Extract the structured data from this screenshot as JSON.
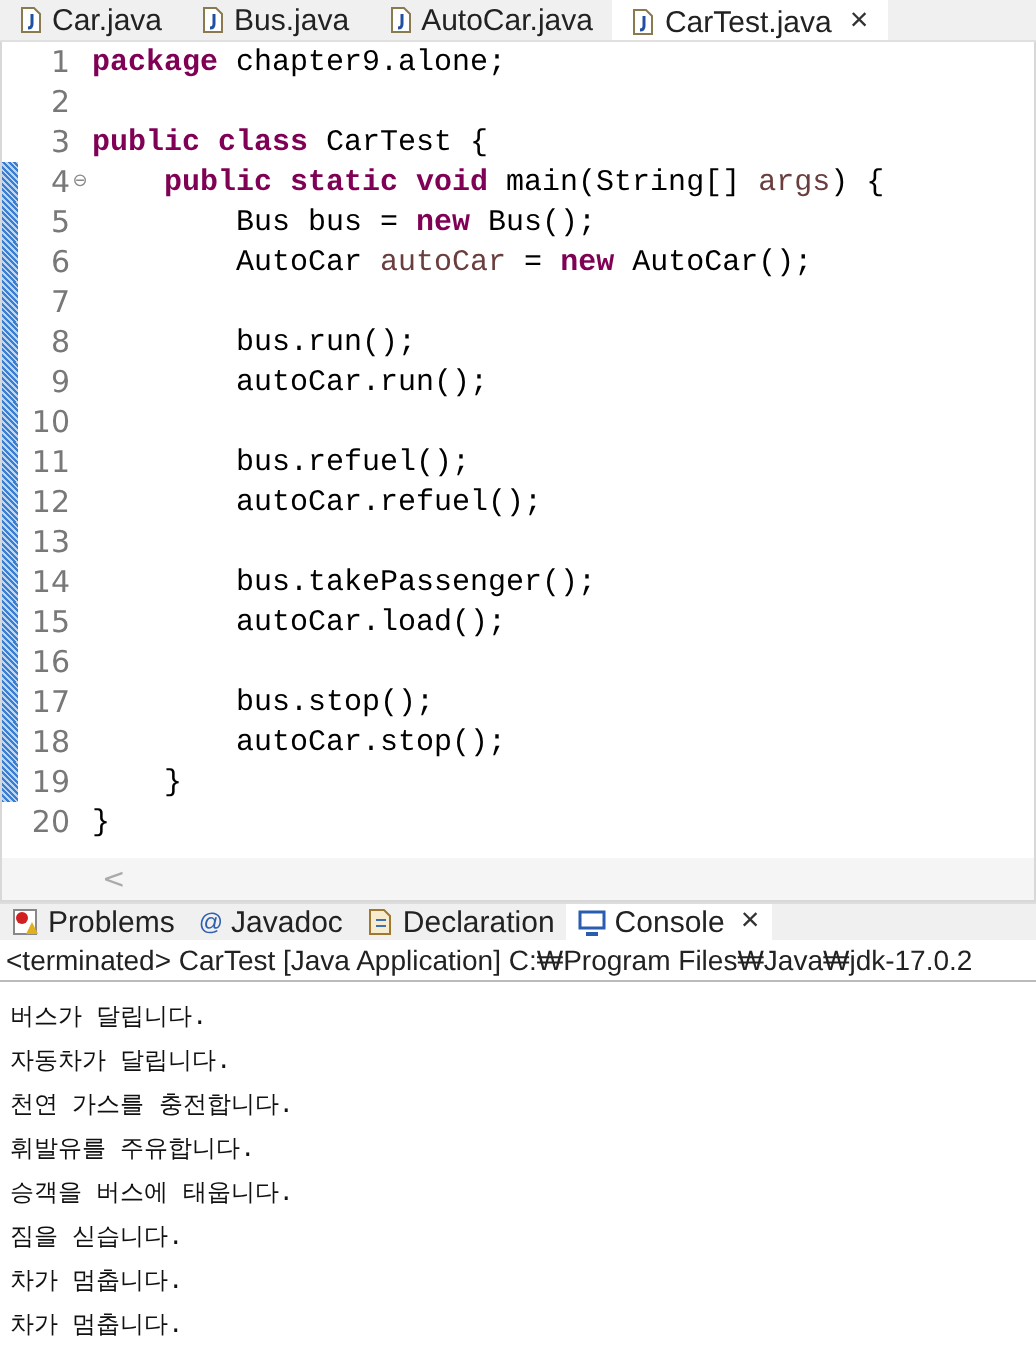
{
  "editor_tabs": [
    {
      "label": "Car.java",
      "selected": false
    },
    {
      "label": "Bus.java",
      "selected": false
    },
    {
      "label": "AutoCar.java",
      "selected": false
    },
    {
      "label": "CarTest.java",
      "selected": true,
      "close": "×"
    }
  ],
  "code": [
    {
      "number": "1",
      "changed": false,
      "tokens": [
        {
          "kind": "keyword",
          "text": "package"
        },
        {
          "kind": "plain",
          "text": " chapter9.alone;"
        }
      ]
    },
    {
      "number": "2",
      "changed": false
    },
    {
      "number": "3",
      "changed": false,
      "tokens": [
        {
          "kind": "keyword",
          "text": "public class"
        },
        {
          "kind": "plain",
          "text": " CarTest {"
        }
      ]
    },
    {
      "number": "4",
      "changed": true,
      "fold": "⊖",
      "tokens": [
        {
          "kind": "keyword",
          "text": "    public static void"
        },
        {
          "kind": "plain",
          "text": " main(String[] "
        },
        {
          "kind": "variable",
          "text": "args"
        },
        {
          "kind": "plain",
          "text": ") {"
        }
      ]
    },
    {
      "number": "5",
      "changed": true,
      "tokens": [
        {
          "kind": "plain",
          "text": "        Bus bus = "
        },
        {
          "kind": "keyword",
          "text": "new"
        },
        {
          "kind": "plain",
          "text": " Bus();"
        }
      ]
    },
    {
      "number": "6",
      "changed": true,
      "tokens": [
        {
          "kind": "plain",
          "text": "        AutoCar "
        },
        {
          "kind": "variable",
          "text": "autoCar"
        },
        {
          "kind": "plain",
          "text": " = "
        },
        {
          "kind": "keyword",
          "text": "new"
        },
        {
          "kind": "plain",
          "text": " AutoCar();"
        }
      ]
    },
    {
      "number": "7",
      "changed": true
    },
    {
      "number": "8",
      "changed": true,
      "tokens": [
        {
          "kind": "plain",
          "text": "        bus.run();"
        }
      ]
    },
    {
      "number": "9",
      "changed": true,
      "tokens": [
        {
          "kind": "plain",
          "text": "        autoCar.run();"
        }
      ]
    },
    {
      "number": "10",
      "changed": true
    },
    {
      "number": "11",
      "changed": true,
      "tokens": [
        {
          "kind": "plain",
          "text": "        bus.refuel();"
        }
      ]
    },
    {
      "number": "12",
      "changed": true,
      "tokens": [
        {
          "kind": "plain",
          "text": "        autoCar.refuel();"
        }
      ]
    },
    {
      "number": "13",
      "changed": true
    },
    {
      "number": "14",
      "changed": true,
      "tokens": [
        {
          "kind": "plain",
          "text": "        bus.takePassenger();"
        }
      ]
    },
    {
      "number": "15",
      "changed": true,
      "tokens": [
        {
          "kind": "plain",
          "text": "        autoCar.load();"
        }
      ]
    },
    {
      "number": "16",
      "changed": true
    },
    {
      "number": "17",
      "changed": true,
      "tokens": [
        {
          "kind": "plain",
          "text": "        bus.stop();"
        }
      ]
    },
    {
      "number": "18",
      "changed": true,
      "tokens": [
        {
          "kind": "plain",
          "text": "        autoCar.stop();"
        }
      ]
    },
    {
      "number": "19",
      "changed": true,
      "tokens": [
        {
          "kind": "plain",
          "text": "    }"
        }
      ]
    },
    {
      "number": "20",
      "changed": false,
      "tokens": [
        {
          "kind": "plain",
          "text": "}"
        }
      ]
    }
  ],
  "scroll_arrow": "<",
  "panel_tabs": [
    {
      "label": "Problems",
      "selected": false
    },
    {
      "label": "Javadoc",
      "icon_char": "@",
      "selected": false
    },
    {
      "label": "Declaration",
      "selected": false
    },
    {
      "label": "Console",
      "selected": true,
      "close": "×"
    }
  ],
  "console": {
    "header": "<terminated> CarTest [Java Application] C:₩Program Files₩Java₩jdk-17.0.2",
    "output": [
      "버스가 달립니다.",
      "자동차가 달립니다.",
      "천연 가스를 충전합니다.",
      "휘발유를 주유합니다.",
      "승객을 버스에 태웁니다.",
      "짐을 싣습니다.",
      "차가 멈춥니다.",
      "차가 멈춥니다."
    ]
  }
}
